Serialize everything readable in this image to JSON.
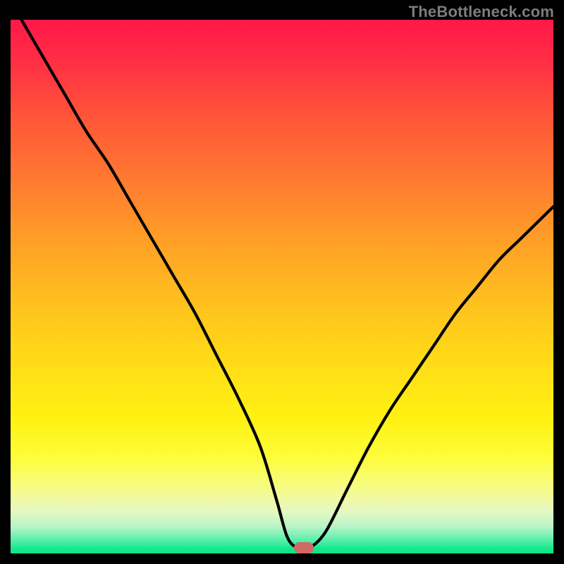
{
  "watermark": "TheBottleneck.com",
  "colors": {
    "frame": "#000000",
    "curve": "#000000",
    "marker": "#cf6a64",
    "gradient_top": "#ff1848",
    "gradient_bottom": "#0be684"
  },
  "chart_data": {
    "type": "line",
    "title": "",
    "xlabel": "",
    "ylabel": "",
    "xlim": [
      0,
      100
    ],
    "ylim": [
      0,
      100
    ],
    "x": [
      2,
      6,
      10,
      14,
      18,
      22,
      26,
      30,
      34,
      38,
      42,
      46,
      49,
      51,
      53,
      55,
      58,
      62,
      66,
      70,
      74,
      78,
      82,
      86,
      90,
      94,
      98,
      100
    ],
    "y": [
      100,
      93,
      86,
      79,
      73,
      66,
      59,
      52,
      45,
      37,
      29,
      20,
      10,
      3,
      1,
      1,
      4,
      12,
      20,
      27,
      33,
      39,
      45,
      50,
      55,
      59,
      63,
      65
    ],
    "marker": {
      "x": 54,
      "y": 1
    },
    "annotations": []
  }
}
